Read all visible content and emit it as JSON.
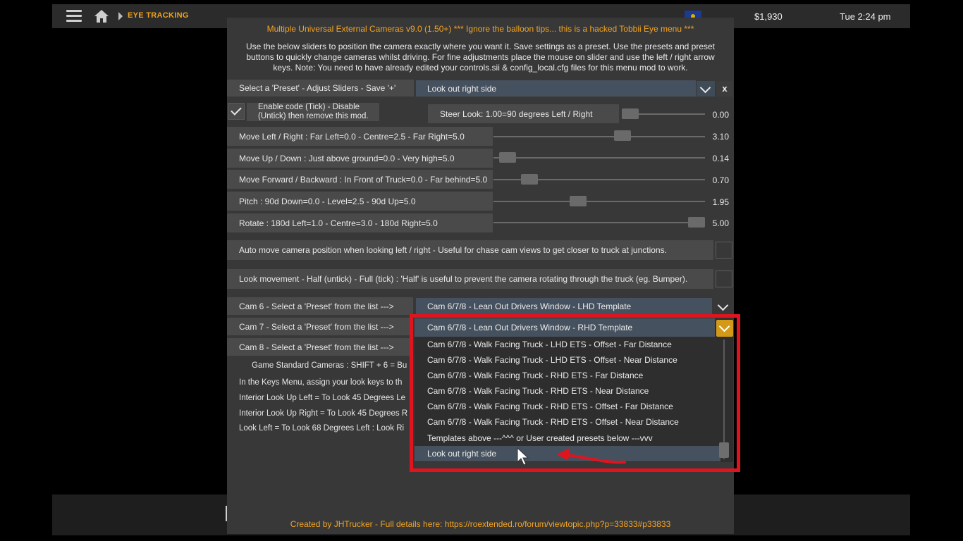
{
  "topbar": {
    "breadcrumb": "EYE TRACKING",
    "money": "$1,930",
    "clock": "Tue 2:24 pm"
  },
  "panel": {
    "title": "Multiple Universal External Cameras v9.0 (1.50+) *** Ignore the balloon tips... this is a hacked Tobbii Eye menu ***",
    "intro": "Use the below sliders to position the camera exactly where you want it. Save settings as a preset. Use the presets and preset buttons to quickly change cameras whilst driving. For fine adjustments place the mouse on slider and use the left / right arrow keys. Note: You need to have already edited your controls.sii & config_local.cfg files for this menu mod to work.",
    "preset_label": "Select a 'Preset' - Adjust Sliders - Save '+'",
    "preset_value": "Look out right side",
    "close_label": "x",
    "enable_label": "Enable code (Tick) - Disable (Untick) then remove this mod.",
    "sliders": [
      {
        "label": "Steer Look: 1.00=90 degrees Left / Right",
        "value": "0.00",
        "level": 0.0
      },
      {
        "label": "Move Left / Right : Far Left=0.0 - Centre=2.5 - Far Right=5.0",
        "value": "3.10",
        "level": 0.62
      },
      {
        "label": "Move Up / Down : Just above ground=0.0 - Very high=5.0",
        "value": "0.14",
        "level": 0.028
      },
      {
        "label": "Move Forward / Backward : In Front of Truck=0.0 - Far behind=5.0",
        "value": "0.70",
        "level": 0.14
      },
      {
        "label": "Pitch : 90d Down=0.0 - Level=2.5 - 90d Up=5.0",
        "value": "1.95",
        "level": 0.39
      },
      {
        "label": "Rotate : 180d Left=1.0 - Centre=3.0 - 180d Right=5.0",
        "value": "5.00",
        "level": 1.0
      }
    ],
    "auto_move_label": "Auto move camera position when looking left / right - Useful for chase cam views to get closer to truck at junctions.",
    "look_movement_label": "Look movement - Half (untick) - Full (tick) : 'Half' is useful to prevent the camera rotating through the truck (eg. Bumper).",
    "cam6_label": "Cam 6 - Select a 'Preset' from the list --->",
    "cam6_value": "Cam 6/7/8 - Lean Out Drivers Window - LHD Template",
    "cam7_label": "Cam 7 - Select a 'Preset' from the list --->",
    "cam8_label": "Cam 8 - Select a 'Preset' from the list --->",
    "info_lines": [
      "Game Standard Cameras  :  SHIFT + 6 = Bu",
      "In the Keys Menu, assign your look keys to th",
      "Interior Look Up Left = To Look 45 Degrees Le",
      "Interior Look Up Right = To Look 45 Degrees R",
      "Look Left = To Look 68 Degrees Left : Look Ri"
    ],
    "footer": "Created by JHTrucker - Full details here: https://roextended.ro/forum/viewtopic.php?p=33833#p33833"
  },
  "dropdown": {
    "selected": "Cam 6/7/8 - Lean Out Drivers Window - RHD Template",
    "options": [
      "Cam 6/7/8 - Walk Facing Truck - LHD ETS - Offset - Far Distance",
      "Cam 6/7/8 - Walk Facing Truck - LHD ETS - Offset - Near Distance",
      "Cam 6/7/8 - Walk Facing Truck - RHD ETS - Far Distance",
      "Cam 6/7/8 - Walk Facing Truck - RHD ETS - Near Distance",
      "Cam 6/7/8 - Walk Facing Truck - RHD ETS - Offset - Far Distance",
      "Cam 6/7/8 - Walk Facing Truck - RHD ETS - Offset - Near Distance",
      "Templates above ---^^^ or User created presets below ---vvv",
      "Look out right side"
    ],
    "highlighted_index": 7
  },
  "colors": {
    "accent": "#f3a423",
    "annotation_red": "#e0141e",
    "dropdown_bg": "#45515e"
  },
  "icons": [
    "menu-icon",
    "home-icon",
    "flag-icon",
    "chevron-down-icon",
    "checkmark-icon",
    "cursor-icon",
    "arrow-annotation"
  ]
}
